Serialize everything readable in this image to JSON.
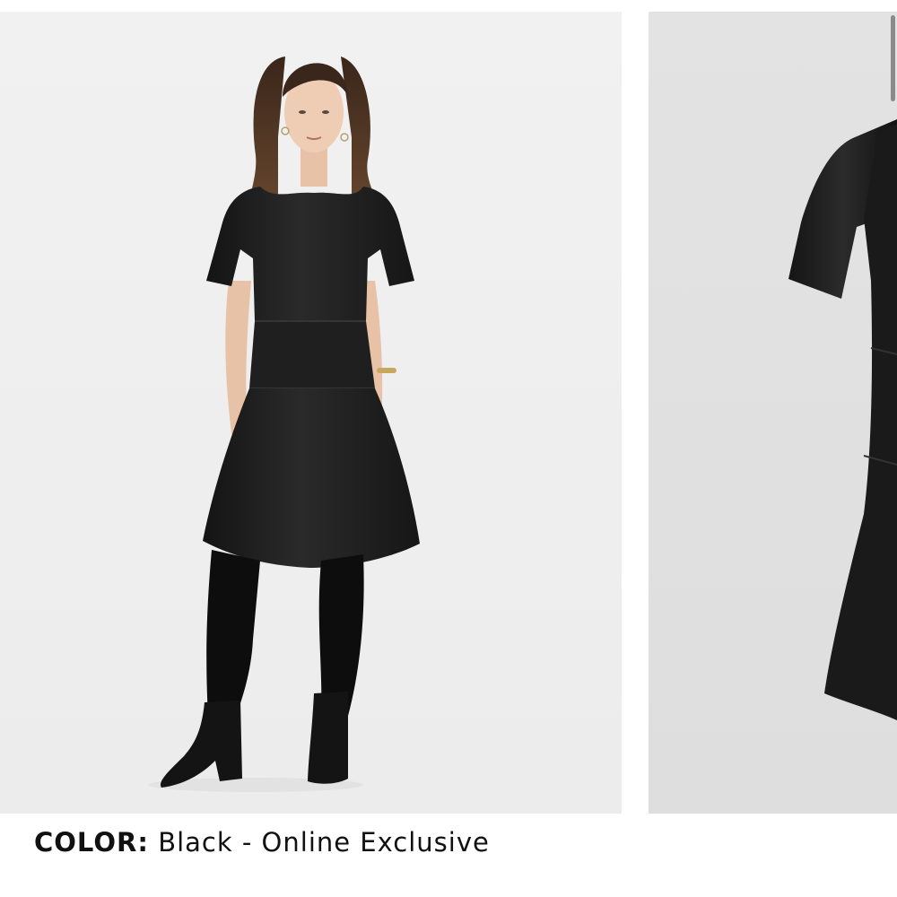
{
  "product_gallery": {
    "main_image": {
      "alt": "model-wearing-dress",
      "subject": "woman in short-sleeve black faux leather fit and flare dress with black tights and suede ankle boots"
    },
    "secondary_image": {
      "alt": "dress-detail",
      "subject": "close-up of black faux leather dress sleeve and skirt"
    }
  },
  "color_selection": {
    "label": "COLOR:",
    "value": "Black - Online Exclusive"
  },
  "colors": {
    "dress": "#1b1b1b",
    "background_main": "#efefef",
    "background_secondary": "#e0e0e0",
    "text": "#111111"
  }
}
